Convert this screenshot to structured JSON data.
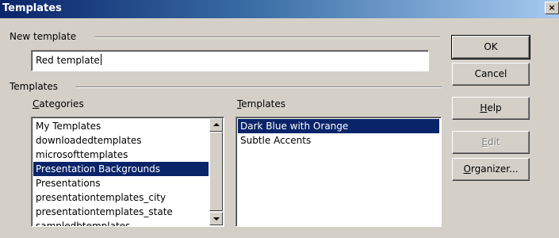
{
  "window": {
    "title": "Templates",
    "close_glyph": "×"
  },
  "new_template": {
    "group_label": "New template",
    "name_value": "Red template"
  },
  "templates_group": {
    "group_label": "Templates"
  },
  "categories": {
    "label_mnemonic": "C",
    "label_rest": "ategories",
    "items": [
      "My Templates",
      "downloadedtemplates",
      "microsofttemplates",
      "Presentation Backgrounds",
      "Presentations",
      "presentationtemplates_city",
      "presentationtemplates_state",
      "sampledbtemplates"
    ],
    "selected": "Presentation Backgrounds"
  },
  "templates_list": {
    "label_mnemonic": "T",
    "label_rest": "emplates",
    "items": [
      "Dark Blue with Orange",
      "Subtle Accents"
    ],
    "selected": "Dark Blue with Orange"
  },
  "buttons": {
    "ok": "OK",
    "cancel": "Cancel",
    "help_mnemonic": "H",
    "help_rest": "elp",
    "edit_mnemonic": "E",
    "edit_rest": "dit",
    "organizer_mnemonic": "O",
    "organizer_rest": "rganizer..."
  },
  "colors": {
    "selection": "#0a246a",
    "dialog_bg": "#d4d0c8",
    "title_start": "#0a246a",
    "title_end": "#a6caf0"
  }
}
